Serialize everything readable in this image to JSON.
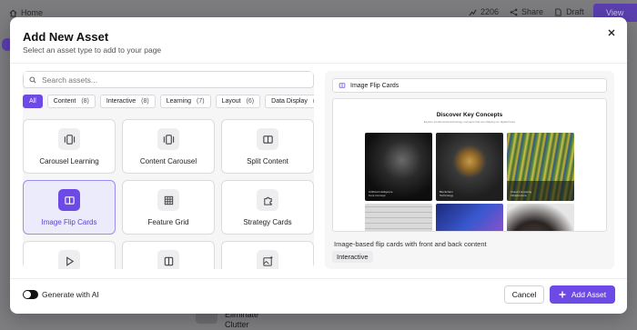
{
  "background": {
    "home_label": "Home",
    "count_label": "2206",
    "share_label": "Share",
    "draft_label": "Draft",
    "view_label": "View",
    "bottom_line1": "Eliminate",
    "bottom_line2": "Clutter"
  },
  "modal": {
    "title": "Add New Asset",
    "subtitle": "Select an asset type to add to your page",
    "close_icon": "close-icon"
  },
  "search": {
    "placeholder": "Search assets...",
    "value": ""
  },
  "filters": [
    {
      "label": "All",
      "count": "",
      "active": true
    },
    {
      "label": "Content",
      "count": "(8)",
      "active": false
    },
    {
      "label": "Interactive",
      "count": "(8)",
      "active": false
    },
    {
      "label": "Learning",
      "count": "(7)",
      "active": false
    },
    {
      "label": "Layout",
      "count": "(6)",
      "active": false
    },
    {
      "label": "Data Display",
      "count": "(",
      "active": false
    }
  ],
  "assets": [
    {
      "label": "Carousel Learning",
      "icon": "carousel-icon",
      "selected": false
    },
    {
      "label": "Content Carousel",
      "icon": "carousel-icon",
      "selected": false
    },
    {
      "label": "Split Content",
      "icon": "split-icon",
      "selected": false
    },
    {
      "label": "Image Flip Cards",
      "icon": "flip-cards-icon",
      "selected": true
    },
    {
      "label": "Feature Grid",
      "icon": "grid-icon",
      "selected": false
    },
    {
      "label": "Strategy Cards",
      "icon": "puzzle-icon",
      "selected": false
    },
    {
      "label": "",
      "icon": "play-icon",
      "selected": false
    },
    {
      "label": "",
      "icon": "columns-icon",
      "selected": false
    },
    {
      "label": "",
      "icon": "image-sparkle-icon",
      "selected": false
    }
  ],
  "preview": {
    "header_label": "Image Flip Cards",
    "image_title": "Discover Key Concepts",
    "image_subtitle": "Explore fundamental technology concepts that are shaping our digital future",
    "cards": [
      {
        "caption1": "Artificial Intelligence",
        "caption2": "Core Concept"
      },
      {
        "caption1": "Blockchain",
        "caption2": "Technology"
      },
      {
        "caption1": "Cloud Computing",
        "caption2": "Infrastructure"
      }
    ],
    "description": "Image-based flip cards with front and back content",
    "tag": "Interactive"
  },
  "footer": {
    "toggle_label": "Generate with AI",
    "toggle_on": true,
    "cancel_label": "Cancel",
    "add_label": "Add Asset"
  },
  "colors": {
    "accent": "#6d4ae6",
    "overlay": "#7d7d80"
  }
}
